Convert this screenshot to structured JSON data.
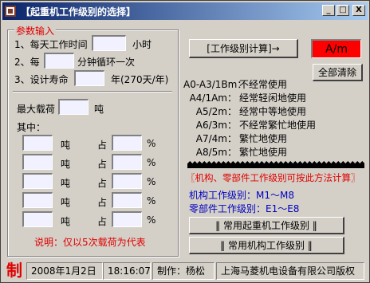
{
  "window": {
    "title": "【起重机工作级别的选择】",
    "minimize": "_",
    "maximize": "□",
    "close": "X"
  },
  "params": {
    "legend": "参数输入",
    "daily_hours_prefix": "1、每天工作时间",
    "daily_hours_unit": "小时",
    "daily_hours_value": "",
    "cycle_prefix": "2、每",
    "cycle_unit": "分钟循环一次",
    "cycle_value": "",
    "life_prefix": "3、设计寿命",
    "life_unit": "年(270天/年)",
    "life_value": "",
    "max_load_label": "最大载荷",
    "max_load_unit": "吨",
    "max_load_value": "",
    "among_label": "其中：",
    "load_rows": [
      {
        "ton_unit": "吨",
        "share_label": "占",
        "percent_unit": "%",
        "ton_value": "",
        "percent_value": ""
      },
      {
        "ton_unit": "吨",
        "share_label": "占",
        "percent_unit": "%",
        "ton_value": "",
        "percent_value": ""
      },
      {
        "ton_unit": "吨",
        "share_label": "占",
        "percent_unit": "%",
        "ton_value": "",
        "percent_value": ""
      },
      {
        "ton_unit": "吨",
        "share_label": "占",
        "percent_unit": "%",
        "ton_value": "",
        "percent_value": ""
      },
      {
        "ton_unit": "吨",
        "share_label": "占",
        "percent_unit": "%",
        "ton_value": "",
        "percent_value": ""
      }
    ],
    "note": "说明：仅以5次载荷为代表"
  },
  "actions": {
    "calc_button": "[工作级别计算]→",
    "result_display": "A/m",
    "clear_button": "全部清除"
  },
  "levels": [
    {
      "code": "A0-A3/1Bm：",
      "desc": "不经常使用"
    },
    {
      "code": "A4/1Am：",
      "desc": "经常轻闲地使用"
    },
    {
      "code": "A5/2m：",
      "desc": "经常中等地使用"
    },
    {
      "code": "A6/3m：",
      "desc": "不经常繁忙地使用"
    },
    {
      "code": "A7/4m：",
      "desc": "繁忙地使用"
    },
    {
      "code": "A8/5m：",
      "desc": "繁忙地使用"
    }
  ],
  "component": {
    "heading": "〖机构、零部件工作级别可按此方法计算〗",
    "mechanism_range": "机构工作级别：M1～M8",
    "part_range": "零部件工作级别：E1～E8",
    "crane_levels_button": "‖ 常用起重机工作级别 ‖",
    "mechanism_levels_button": "‖ 常用机构工作级别 ‖"
  },
  "status": {
    "logo": "制",
    "date": "2008年1月2日",
    "time": "18:16:07",
    "author": "制作：杨松",
    "company": "上海马菱机电设备有限公司版权"
  },
  "colors": {
    "accent_red": "#e00000",
    "result_bg": "#ff0000",
    "component_blue": "#0000c0",
    "field_bg": "#f1f1ff"
  }
}
